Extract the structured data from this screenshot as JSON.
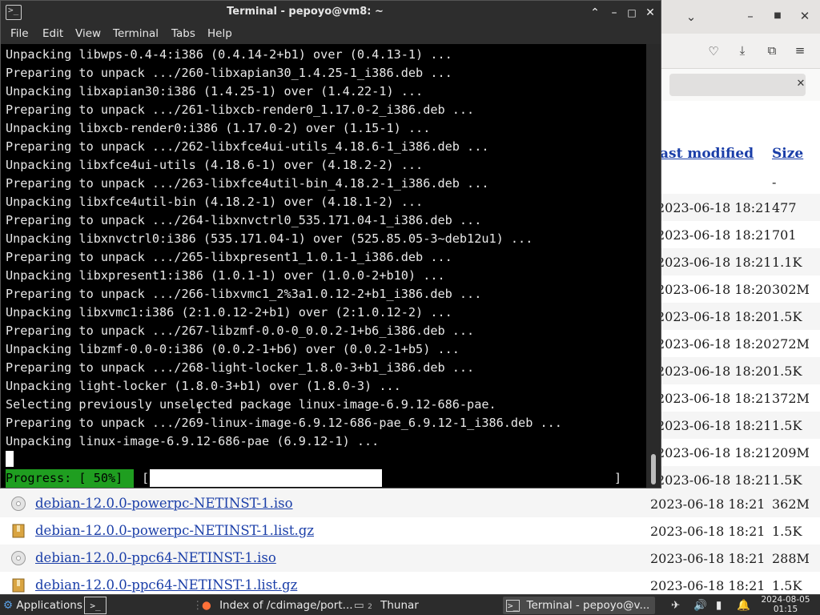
{
  "browser": {
    "columns": {
      "last_modified": "ast modified",
      "size": "Size"
    },
    "parent_row": {
      "size": "-"
    },
    "partial_rows": [
      {
        "date": "2023-06-18 18:21",
        "size": "477"
      },
      {
        "date": "2023-06-18 18:21",
        "size": "701"
      },
      {
        "date": "2023-06-18 18:21",
        "size": "1.1K"
      },
      {
        "date": "2023-06-18 18:20",
        "size": "302M"
      },
      {
        "date": "2023-06-18 18:20",
        "size": "1.5K"
      },
      {
        "date": "2023-06-18 18:20",
        "size": "272M"
      },
      {
        "date": "2023-06-18 18:20",
        "size": "1.5K"
      },
      {
        "date": "2023-06-18 18:21",
        "size": "372M"
      },
      {
        "date": "2023-06-18 18:21",
        "size": "1.5K"
      },
      {
        "date": "2023-06-18 18:21",
        "size": "209M"
      },
      {
        "date": "2023-06-18 18:21",
        "size": "1.5K"
      }
    ],
    "rows": [
      {
        "name": "debian-12.0.0-powerpc-NETINST-1.iso",
        "date": "2023-06-18 18:21",
        "size": "362M",
        "icon": "disc-icon"
      },
      {
        "name": "debian-12.0.0-powerpc-NETINST-1.list.gz",
        "date": "2023-06-18 18:21",
        "size": "1.5K",
        "icon": "archive-icon"
      },
      {
        "name": "debian-12.0.0-ppc64-NETINST-1.iso",
        "date": "2023-06-18 18:21",
        "size": "288M",
        "icon": "disc-icon"
      },
      {
        "name": "debian-12.0.0-ppc64-NETINST-1.list.gz",
        "date": "2023-06-18 18:21",
        "size": "1.5K",
        "icon": "archive-icon"
      }
    ]
  },
  "terminal": {
    "title": "Terminal - pepoyo@vm8: ~",
    "menu": [
      "File",
      "Edit",
      "View",
      "Terminal",
      "Tabs",
      "Help"
    ],
    "lines": [
      "Unpacking libwps-0.4-4:i386 (0.4.14-2+b1) over (0.4.13-1) ...",
      "Preparing to unpack .../260-libxapian30_1.4.25-1_i386.deb ...",
      "Unpacking libxapian30:i386 (1.4.25-1) over (1.4.22-1) ...",
      "Preparing to unpack .../261-libxcb-render0_1.17.0-2_i386.deb ...",
      "Unpacking libxcb-render0:i386 (1.17.0-2) over (1.15-1) ...",
      "Preparing to unpack .../262-libxfce4ui-utils_4.18.6-1_i386.deb ...",
      "Unpacking libxfce4ui-utils (4.18.6-1) over (4.18.2-2) ...",
      "Preparing to unpack .../263-libxfce4util-bin_4.18.2-1_i386.deb ...",
      "Unpacking libxfce4util-bin (4.18.2-1) over (4.18.1-2) ...",
      "Preparing to unpack .../264-libxnvctrl0_535.171.04-1_i386.deb ...",
      "Unpacking libxnvctrl0:i386 (535.171.04-1) over (525.85.05-3~deb12u1) ...",
      "Preparing to unpack .../265-libxpresent1_1.0.1-1_i386.deb ...",
      "Unpacking libxpresent1:i386 (1.0.1-1) over (1.0.0-2+b10) ...",
      "Preparing to unpack .../266-libxvmc1_2%3a1.0.12-2+b1_i386.deb ...",
      "Unpacking libxvmc1:i386 (2:1.0.12-2+b1) over (2:1.0.12-2) ...",
      "Preparing to unpack .../267-libzmf-0.0-0_0.0.2-1+b6_i386.deb ...",
      "Unpacking libzmf-0.0-0:i386 (0.0.2-1+b6) over (0.0.2-1+b5) ...",
      "Preparing to unpack .../268-light-locker_1.8.0-3+b1_i386.deb ...",
      "Unpacking light-locker (1.8.0-3+b1) over (1.8.0-3) ...",
      "Selecting previously unselected package linux-image-6.9.12-686-pae.",
      "Preparing to unpack .../269-linux-image-6.9.12-686-pae_6.9.12-1_i386.deb ...",
      "Unpacking linux-image-6.9.12-686-pae (6.9.12-1) ..."
    ],
    "progress_label": "Progress: [ 50%]",
    "progress_open": "[",
    "progress_close": "]",
    "progress_fraction": 0.5
  },
  "taskbar": {
    "applications": "Applications",
    "browser_task": "Index of /cdimage/port...",
    "files_task": "Thunar",
    "files_badge": "2",
    "terminal_task": "Terminal - pepoyo@v...",
    "date": "2024-08-05",
    "time": "01:15"
  },
  "colors": {
    "progress_green": "#1f9e20",
    "link_blue": "#1a3ea8",
    "terminal_bg": "#000000"
  }
}
